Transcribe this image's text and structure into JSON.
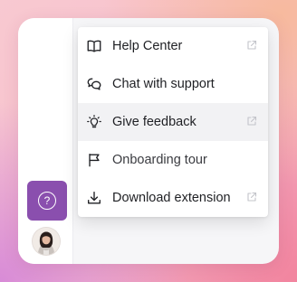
{
  "sidebar": {
    "help_button": {
      "icon": "question-mark-icon",
      "glyph": "?",
      "color": "#8a4fae"
    },
    "avatar": {
      "icon": "user-avatar"
    }
  },
  "menu": {
    "items": [
      {
        "label": "Help Center",
        "icon": "book-icon",
        "external": true
      },
      {
        "label": "Chat with support",
        "icon": "chat-bubbles-icon",
        "external": false
      },
      {
        "label": "Give feedback",
        "icon": "lightbulb-icon",
        "external": true,
        "active": true
      },
      {
        "label": "Onboarding tour",
        "icon": "flag-icon",
        "external": false
      },
      {
        "label": "Download extension",
        "icon": "download-icon",
        "external": true
      }
    ]
  }
}
